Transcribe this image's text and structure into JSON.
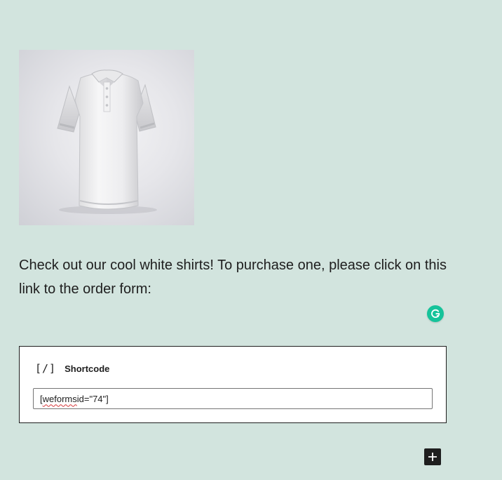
{
  "image_block": {
    "alt": "White polo shirt"
  },
  "paragraph": {
    "text": "Check out our cool white shirts!  To purchase one, please click on this link to the order form:"
  },
  "grammarly": {
    "icon": "grammarly-icon",
    "color": "#15c39a"
  },
  "shortcode_block": {
    "icon_text": "[/]",
    "label": "Shortcode",
    "input": {
      "value_misspelled": "weforms",
      "value_prefix": "[",
      "value_suffix": " id=\"74\"]"
    }
  },
  "inserter": {
    "icon": "plus-icon"
  },
  "colors": {
    "background": "#d2e4de",
    "text": "#1e1e1e",
    "block_border": "#1e1e1e"
  }
}
